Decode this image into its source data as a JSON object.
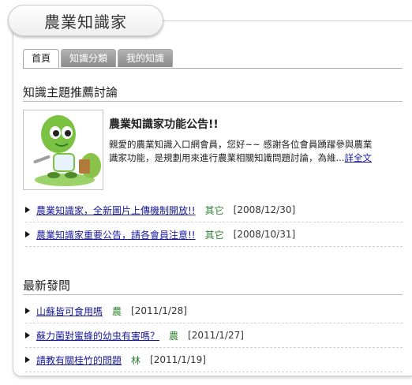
{
  "header": {
    "title": "農業知識家"
  },
  "tabs": [
    {
      "label": "首頁",
      "active": true
    },
    {
      "label": "知識分類",
      "active": false
    },
    {
      "label": "我的知識",
      "active": false
    }
  ],
  "featured": {
    "section_title": "知識主題推薦討論",
    "article": {
      "title": "農業知識家功能公告!!",
      "line1": "親愛的農業知識入口網會員，您好~~ 感謝各位會員踴躍參與農業",
      "line2": "識家功能，是規劃用來進行農業相關知識問題討論，為維...",
      "more_link": "詳全文"
    },
    "items": [
      {
        "title": "農業知識家，全新圖片上傳機制開放!!",
        "category": "其它",
        "date": "[2008/12/30]"
      },
      {
        "title": "農業知識家重要公告，請各會員注意!!",
        "category": "其它",
        "date": "[2008/10/31]"
      }
    ]
  },
  "latest": {
    "section_title": "最新發問",
    "items": [
      {
        "title": "山蘇皆可食用嗎",
        "category": "農",
        "date": "[2011/1/28]"
      },
      {
        "title": "蘇力菌對蜜蜂的幼虫有害嗎？",
        "category": "農",
        "date": "[2011/1/27]"
      },
      {
        "title": "請教有關桂竹的問題",
        "category": "林",
        "date": "[2011/1/19]"
      }
    ]
  },
  "colors": {
    "link": "#1a1a99",
    "category": "#2e7d32",
    "mascot_green": "#7cc242"
  }
}
